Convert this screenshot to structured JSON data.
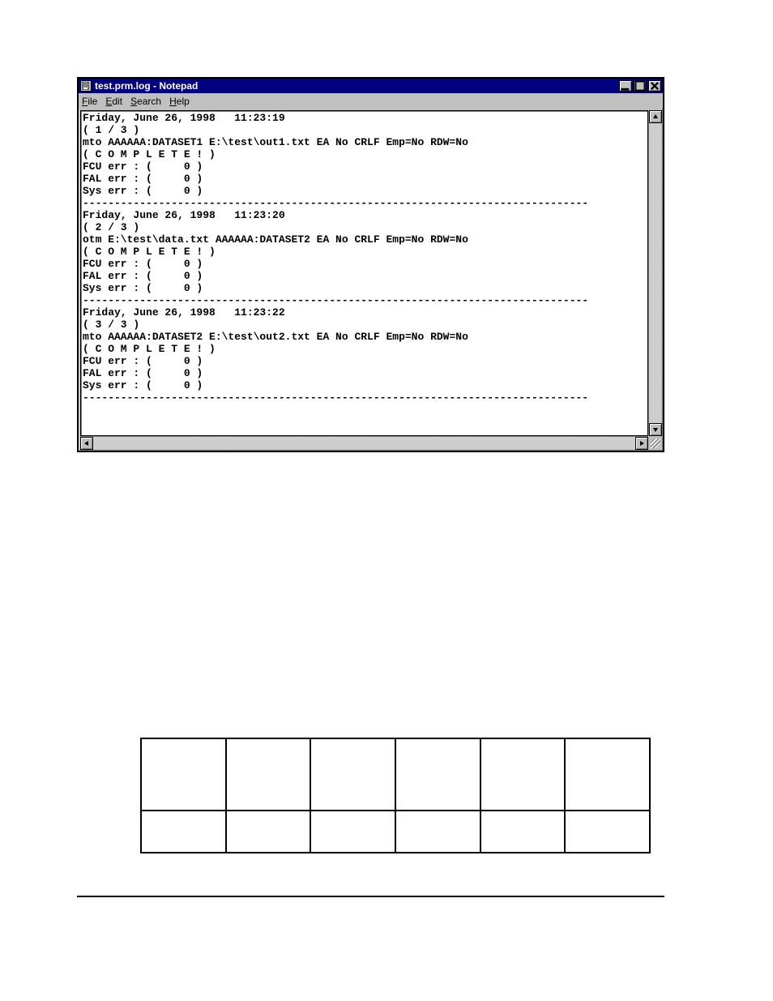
{
  "window": {
    "title": "test.prm.log - Notepad",
    "menu": {
      "file": "File",
      "edit": "Edit",
      "search": "Search",
      "help": "Help"
    }
  },
  "log": {
    "text": "Friday, June 26, 1998   11:23:19\n( 1 / 3 )\nmto AAAAAA:DATASET1 E:\\test\\out1.txt EA No CRLF Emp=No RDW=No\n( C O M P L E T E ! )\nFCU err : (     0 )\nFAL err : (     0 )\nSys err : (     0 )\n--------------------------------------------------------------------------------\nFriday, June 26, 1998   11:23:20\n( 2 / 3 )\notm E:\\test\\data.txt AAAAAA:DATASET2 EA No CRLF Emp=No RDW=No\n( C O M P L E T E ! )\nFCU err : (     0 )\nFAL err : (     0 )\nSys err : (     0 )\n--------------------------------------------------------------------------------\nFriday, June 26, 1998   11:23:22\n( 3 / 3 )\nmto AAAAAA:DATASET2 E:\\test\\out2.txt EA No CRLF Emp=No RDW=No\n( C O M P L E T E ! )\nFCU err : (     0 )\nFAL err : (     0 )\nSys err : (     0 )\n--------------------------------------------------------------------------------"
  },
  "table": {
    "rows": 2,
    "cols": 6
  }
}
